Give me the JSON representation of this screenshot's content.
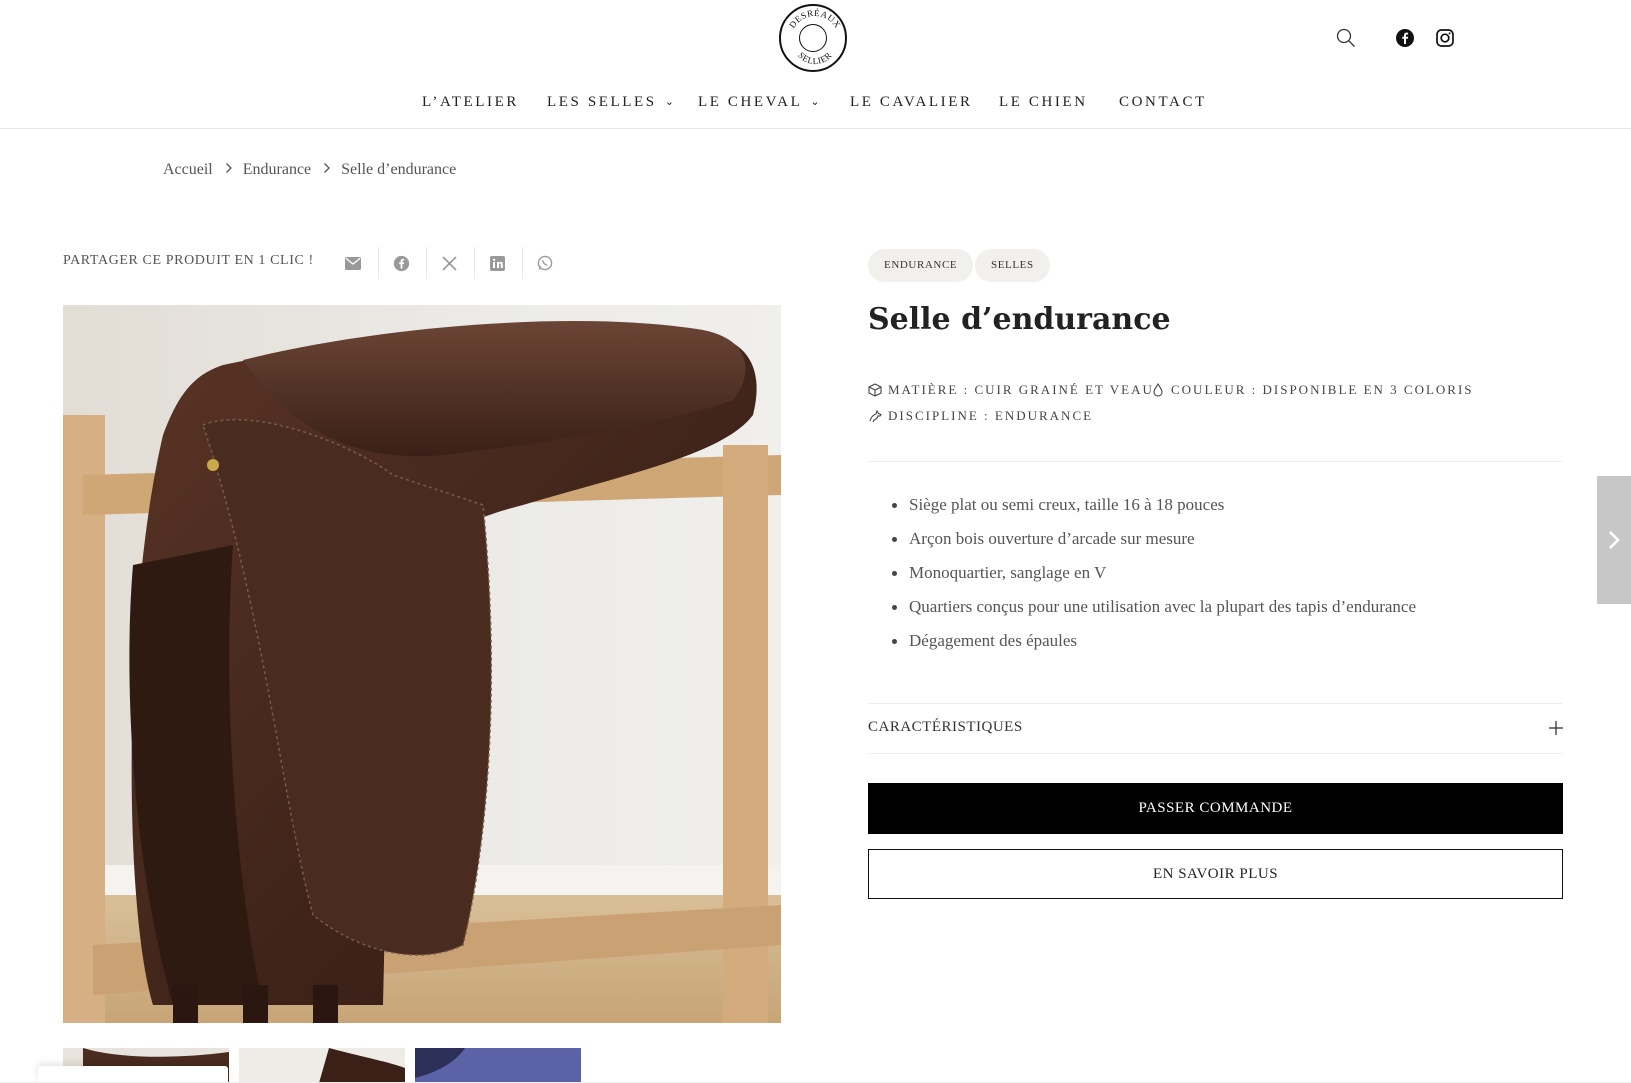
{
  "header": {
    "logo": {
      "top_text": "DESRÉAUX",
      "bottom_text": "SELLIER"
    },
    "nav": [
      {
        "label": "L’ATELIER",
        "dropdown": false
      },
      {
        "label": "LES SELLES",
        "dropdown": true
      },
      {
        "label": "LE CHEVAL",
        "dropdown": true
      },
      {
        "label": "LE CAVALIER",
        "dropdown": false
      },
      {
        "label": "LE CHIEN",
        "dropdown": false
      },
      {
        "label": "CONTACT",
        "dropdown": false
      }
    ],
    "icons": [
      "search-icon",
      "facebook-icon",
      "instagram-icon"
    ]
  },
  "breadcrumb": [
    "Accueil",
    "Endurance",
    "Selle d’endurance"
  ],
  "share": {
    "label": "PARTAGER CE PRODUIT EN 1 CLIC !",
    "icons": [
      "email-icon",
      "facebook-icon",
      "x-icon",
      "linkedin-icon",
      "whatsapp-icon"
    ]
  },
  "product": {
    "tags": [
      "ENDURANCE",
      "SELLES"
    ],
    "title": "Selle d’endurance",
    "attributes": {
      "matiere": "MATIÈRE : CUIR GRAINÉ ET VEAU",
      "couleur": "COULEUR : DISPONIBLE EN 3 COLORIS",
      "discipline": "DISCIPLINE : ENDURANCE"
    },
    "features": [
      "Siège plat ou semi creux, taille 16 à 18 pouces",
      "Arçon bois ouverture d’arcade sur mesure",
      "Monoquartier, sanglage en V",
      "Quartiers conçus pour une utilisation avec la plupart des tapis d’endurance",
      "Dégagement des épaules"
    ],
    "accordion_label": "CARACTÉRISTIQUES",
    "primary_button": "PASSER COMMANDE",
    "secondary_button": "EN SAVOIR PLUS"
  },
  "colors": {
    "accent": "#000000",
    "tag_bg": "#f2f0ed",
    "leather": "#4a2a1e"
  }
}
